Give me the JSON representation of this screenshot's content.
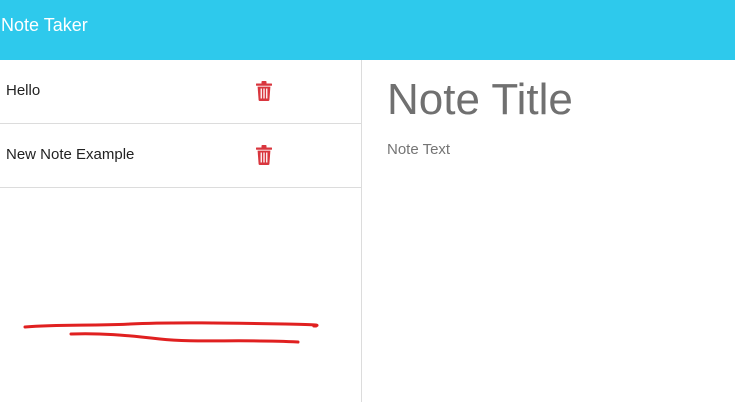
{
  "navbar": {
    "brand": "Note Taker",
    "background_color": "#2ec9ec"
  },
  "notes": [
    {
      "title": "Hello",
      "delete_icon": "trash-icon"
    },
    {
      "title": "New Note Example",
      "delete_icon": "trash-icon"
    }
  ],
  "editor": {
    "title_placeholder": "Note Title",
    "text_placeholder": "Note Text"
  },
  "colors": {
    "delete_icon": "#d9363e",
    "scribble": "#e02020"
  }
}
